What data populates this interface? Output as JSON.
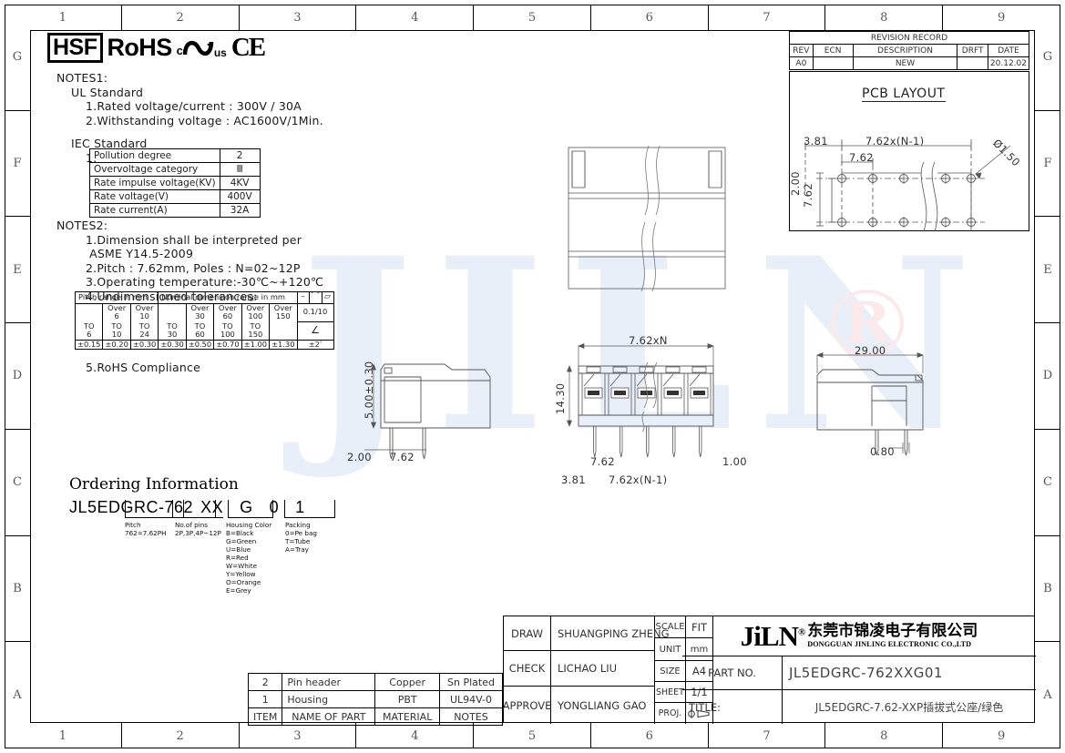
{
  "sheet": {
    "zone_columns": [
      "1",
      "2",
      "3",
      "4",
      "5",
      "6",
      "7",
      "8",
      "9"
    ],
    "zone_rows": [
      "G",
      "F",
      "E",
      "D",
      "C",
      "B",
      "A"
    ]
  },
  "logos": {
    "hsf": "HSF",
    "rohs": "RoHS",
    "ul_c": "c",
    "ul_us": "us",
    "ul_star": "*",
    "ce": "CE"
  },
  "notes1": {
    "heading": "NOTES1:",
    "subheading": "UL Standard",
    "lines": [
      "1.Rated voltage/current : 300V / 30A",
      "2.Withstanding voltage : AC1600V/1Min."
    ],
    "iec_heading": "IEC Standard",
    "iec_index": "1."
  },
  "iec_table": {
    "rows": [
      {
        "label": "Pollution degree",
        "value": "2"
      },
      {
        "label": "Overvoltage category",
        "value": "Ⅲ"
      },
      {
        "label": "Rate impulse voltage(KV)",
        "value": "4KV"
      },
      {
        "label": "Rate voltage(V)",
        "value": "400V"
      },
      {
        "label": "Rate current(A)",
        "value": "32A"
      }
    ]
  },
  "notes2": {
    "heading": "NOTES2:",
    "lines": [
      "1.Dimension shall be interpreted per",
      " ASME Y14.5-2009",
      "2.Pitch : 7.62mm, Poles : N=02~12P",
      "3.Operating temperature:-30℃~+120℃",
      "4.Undimensioned tolerances:"
    ],
    "trailing": "5.RoHS Compliance"
  },
  "tolerance_table": {
    "header_pitch": "Pitch range in mm",
    "header_nominal": "Nominal dimension range in mm",
    "sym_dash": "–",
    "sym_arc": "⌒",
    "sym_par": "▱",
    "ranges": [
      {
        "over": "",
        "to": "TO\n6"
      },
      {
        "over": "Over\n6",
        "to": "TO\n10"
      },
      {
        "over": "Over\n10",
        "to": "TO\n24"
      },
      {
        "over": "",
        "to": "TO\n30"
      },
      {
        "over": "Over\n30",
        "to": "TO\n60"
      },
      {
        "over": "Over\n60",
        "to": "TO\n100"
      },
      {
        "over": "Over\n100",
        "to": "TO\n150"
      },
      {
        "over": "Over\n150",
        "to": ""
      }
    ],
    "tolerances": [
      "±0.15",
      "±0.20",
      "±0.30",
      "±0.30",
      "±0.50",
      "±0.70",
      "±1.00",
      "±1.30"
    ],
    "angular_top": "0.1/10",
    "angular_mid": "∠",
    "angular_value": "±2ʹ"
  },
  "ordering": {
    "title": "Ordering Information",
    "prefix": "JL5EDGRC-",
    "seg_pitch": "762",
    "seg_pins": "XX",
    "seg_color": "G",
    "seg_pack0": "0",
    "seg_pack1": "1",
    "legend_pitch": "Pitch\n762=7.62PH",
    "legend_pins": "No.of pins\n2P,3P,4P~12P",
    "legend_color": "Housing Color\nB=Black\nG=Green\nU=Blue\nR=Red\nW=White\nY=Yellow\nO=Orange\nE=Grey",
    "legend_packing": "Packing\n0=Pe bag\nT=Tube\nA=Tray"
  },
  "revision": {
    "title": "REVISION RECORD",
    "headers": [
      "REV",
      "ECN",
      "DESCRIPTION",
      "DRFT",
      "DATE"
    ],
    "rows": [
      {
        "rev": "A0",
        "ecn": "",
        "description": "NEW",
        "drft": "",
        "date": "20.12.02"
      }
    ]
  },
  "pcb_layout": {
    "title": "PCB LAYOUT",
    "dim_edge": "3.81",
    "dim_span": "7.62x(N-1)",
    "dim_pitch": "7.62",
    "dim_row": "7.62",
    "dim_offset": "2.00",
    "dim_hole": "Ø1.50"
  },
  "views": {
    "side_left": {
      "height": "5.00±0.30",
      "edge": "2.00",
      "pitch": "7.62"
    },
    "front": {
      "width": "7.62xN",
      "height": "14.30",
      "pitch": "7.62",
      "span": "7.62x(N-1)",
      "edge": "3.81",
      "pin_width": "1.00"
    },
    "side_right": {
      "length": "29.00",
      "pin": "0.80"
    }
  },
  "parts_list": {
    "rows": [
      {
        "item": "2",
        "name": "Pin header",
        "material": "Copper",
        "notes": "Sn Plated"
      },
      {
        "item": "1",
        "name": "Housing",
        "material": "PBT",
        "notes": "UL94V-0"
      }
    ],
    "headers": {
      "item": "ITEM",
      "name": "NAME OF PART",
      "material": "MATERIAL",
      "notes": "NOTES"
    }
  },
  "title_block": {
    "draw_label": "DRAW",
    "draw_value": "SHUANGPING ZHENG",
    "check_label": "CHECK",
    "check_value": "LICHAO  LIU",
    "approve_label": "APPROVE",
    "approve_value": "YONGLIANG GAO",
    "scale_label": "SCALE",
    "scale_value": "FIT",
    "unit_label": "UNIT",
    "unit_value": "mm",
    "size_label": "SIZE",
    "size_value": "A4",
    "sheet_label": "SHEET",
    "sheet_value": "1/1",
    "proj_label": "PROJ.",
    "company_logo": "JiLN",
    "company_reg": "®",
    "company_cn": "东莞市锦凌电子有限公司",
    "company_en": "DONGGUAN JINLING ELECTRONIC CO.,LTD",
    "part_no_label": "PART NO.",
    "part_no_value": "JL5EDGRC-762XXG01",
    "title_label": "TITLE:",
    "title_value": "JL5EDGRC-7.62-XXP插拔式公座/绿色"
  },
  "watermark": {
    "text": "JILN",
    "mark": "R"
  }
}
